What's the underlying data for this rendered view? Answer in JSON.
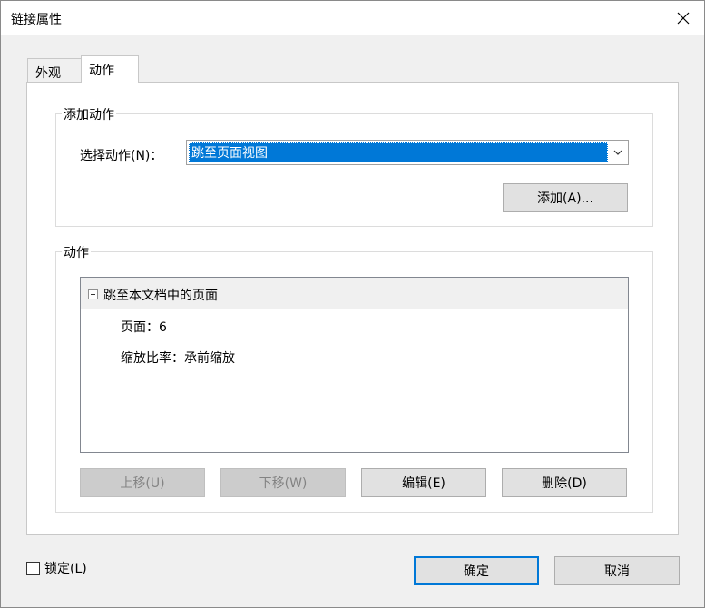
{
  "window": {
    "title": "链接属性",
    "close_icon": "close-icon"
  },
  "tabs": [
    {
      "label": "外观",
      "selected": false
    },
    {
      "label": "动作",
      "selected": true
    }
  ],
  "add_action": {
    "legend": "添加动作",
    "select_label": "选择动作(N)：",
    "select_value": "跳至页面视图",
    "add_button": "添加(A)..."
  },
  "actions": {
    "legend": "动作",
    "tree": {
      "root_label": "跳至本文档中的页面",
      "details": [
        "页面：6",
        "缩放比率：承前缩放"
      ]
    },
    "buttons": {
      "move_up": "上移(U)",
      "move_down": "下移(W)",
      "edit": "编辑(E)",
      "delete": "删除(D)"
    }
  },
  "footer": {
    "lock_label": "锁定(L)",
    "lock_checked": false,
    "ok": "确定",
    "cancel": "取消"
  },
  "colors": {
    "selection": "#0078d7",
    "window_bg": "#f0f0f0",
    "button_bg": "#e1e1e1",
    "disabled_button_bg": "#cccccc"
  }
}
